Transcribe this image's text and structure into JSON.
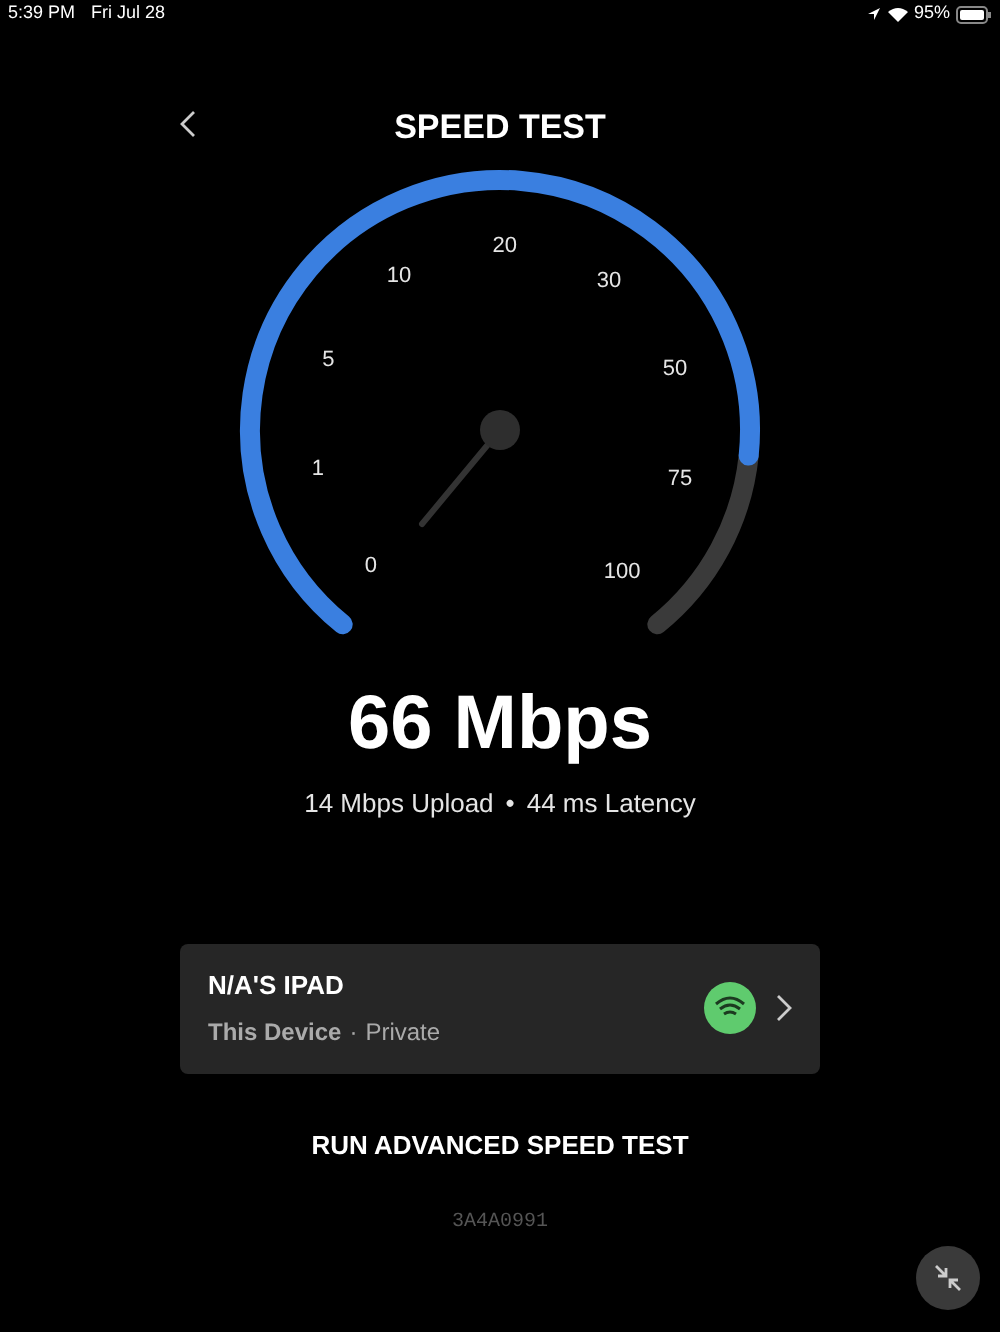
{
  "status_bar": {
    "time": "5:39 PM",
    "date": "Fri Jul 28",
    "battery": "95%"
  },
  "header": {
    "title": "SPEED TEST"
  },
  "gauge": {
    "labels": [
      "0",
      "1",
      "5",
      "10",
      "20",
      "30",
      "50",
      "75",
      "100"
    ]
  },
  "result": {
    "speed": "66 Mbps",
    "upload": "14 Mbps Upload",
    "separator": "•",
    "latency": "44 ms Latency"
  },
  "device": {
    "name": "N/A'S IPAD",
    "type": "This Device",
    "separator": "·",
    "network": "Private"
  },
  "advanced_button": "RUN ADVANCED SPEED TEST",
  "code": "3A4A0991"
}
